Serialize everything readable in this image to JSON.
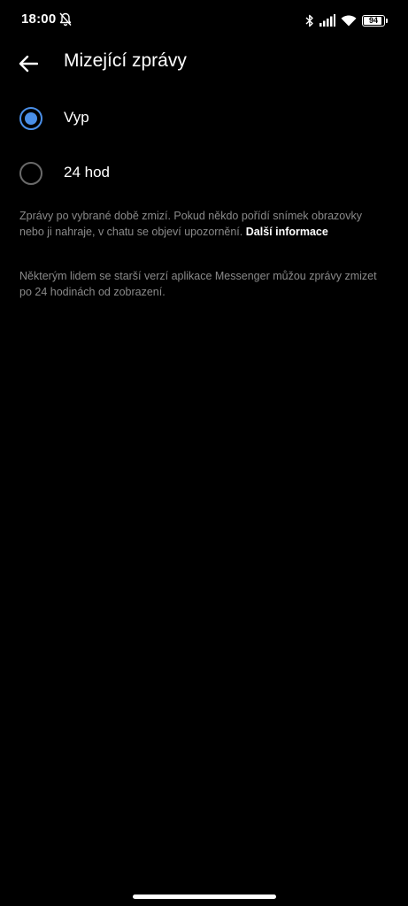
{
  "status_bar": {
    "time": "18:00",
    "battery": "94",
    "battery_level": 0.94,
    "icons": [
      "bell-off-icon",
      "bluetooth-icon",
      "signal-icon",
      "wifi-icon",
      "battery-icon"
    ]
  },
  "header": {
    "title": "Mizející zprávy",
    "back_icon": "arrow-left-icon"
  },
  "options": [
    {
      "label": "Vyp",
      "selected": true
    },
    {
      "label": "24 hod",
      "selected": false
    }
  ],
  "info": {
    "paragraph1": "Zprávy po vybrané době zmizí. Pokud někdo pořídí snímek obrazovky nebo ji nahraje, v chatu se objeví upozornění.",
    "link": "Další informace",
    "paragraph2": "Některým lidem se starší verzí aplikace Messenger můžou zprávy zmizet po 24 hodinách od zobrazení."
  },
  "colors": {
    "background": "#000000",
    "accent": "#4a8fe8",
    "text": "#ffffff",
    "secondary_text": "#8a8a8a"
  }
}
